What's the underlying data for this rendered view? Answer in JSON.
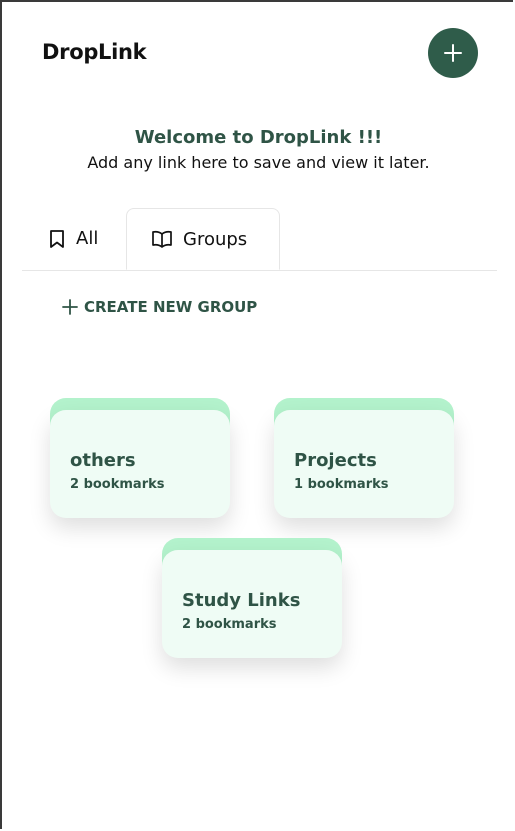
{
  "app": {
    "logo": "DropLink",
    "add_button_icon": "plus-icon",
    "accent_color": "#2f5c4a"
  },
  "welcome": {
    "title": "Welcome to DropLink !!!",
    "subtitle": "Add any link here to save and view it later."
  },
  "tabs": [
    {
      "label": "All",
      "icon": "bookmark-icon",
      "active": false
    },
    {
      "label": "Groups",
      "icon": "book-open-icon",
      "active": true
    }
  ],
  "groups_page": {
    "create_label": "CREATE NEW GROUP",
    "create_icon": "plus-icon"
  },
  "groups": [
    {
      "name": "others",
      "count": "2 bookmarks"
    },
    {
      "name": "Projects",
      "count": "1 bookmarks"
    },
    {
      "name": "Study Links",
      "count": "2 bookmarks"
    }
  ],
  "colors": {
    "card_tab": "#b3f2cc",
    "card_body": "#effcf5",
    "heading_text": "#2f5446"
  }
}
